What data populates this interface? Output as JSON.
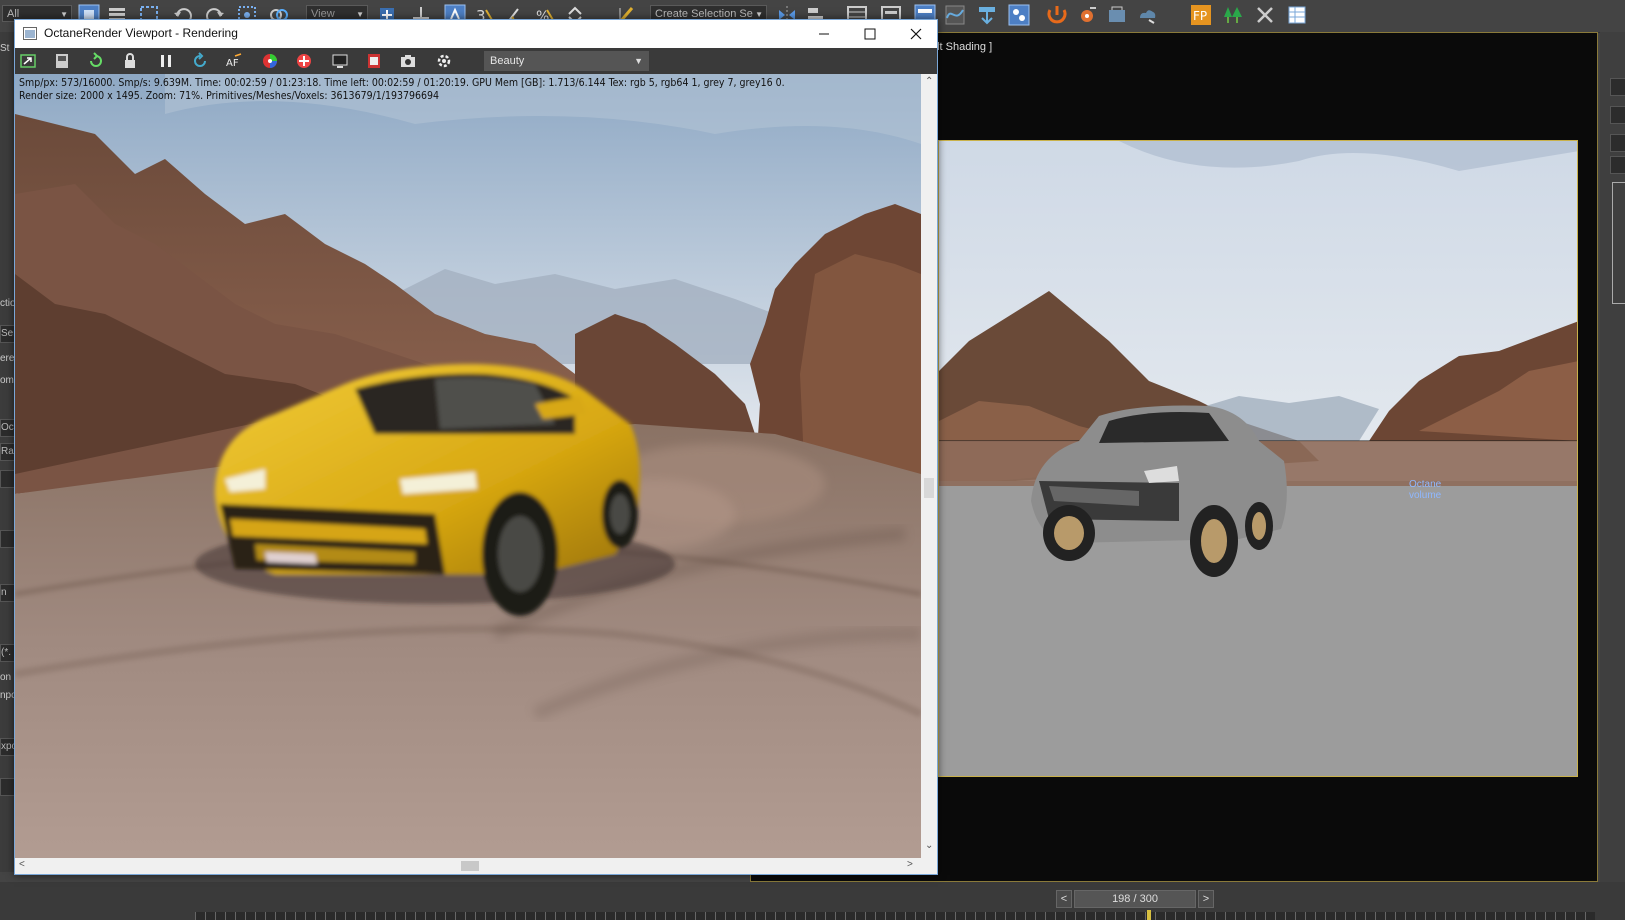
{
  "main_toolbar": {
    "selection_filter": "All",
    "reference_coord": "View",
    "named_selection_placeholder": "Create Selection Se"
  },
  "octane_window": {
    "title": "OctaneRender Viewport - Rendering",
    "pass_selected": "Beauty",
    "stats_line1": "Smp/px: 573/16000.   Smp/s: 9.639M.   Time: 00:02:59 / 01:23:18.   Time left: 00:02:59 / 01:20:19.   GPU Mem [GB]: 1.713/6.144   Tex: rgb 5, rgb64 1, grey 7, grey16 0.",
    "stats_line2": "Render size: 2000 x 1495.   Zoom: 71%.   Primitives/Meshes/Voxels: 3613679/1/193796694"
  },
  "background_viewport": {
    "label_fragment": "ult Shading ]",
    "object_label": "Octane\nvolume"
  },
  "timeline": {
    "frame_display": "198 / 300",
    "prev_label": "<",
    "next_label": ">"
  },
  "left_panel": {
    "fragments": [
      "St",
      "ctio",
      "Sen",
      "ere",
      "om",
      "Oct",
      "Ra",
      "n",
      "(*.",
      "on",
      "npo",
      "xpo"
    ]
  },
  "colors": {
    "max_bg": "#444444",
    "safe_frame": "#c9b14a",
    "octane_border": "#7aa7d8",
    "car_yellow": "#e2b318",
    "object_label": "#8fb8ff"
  }
}
